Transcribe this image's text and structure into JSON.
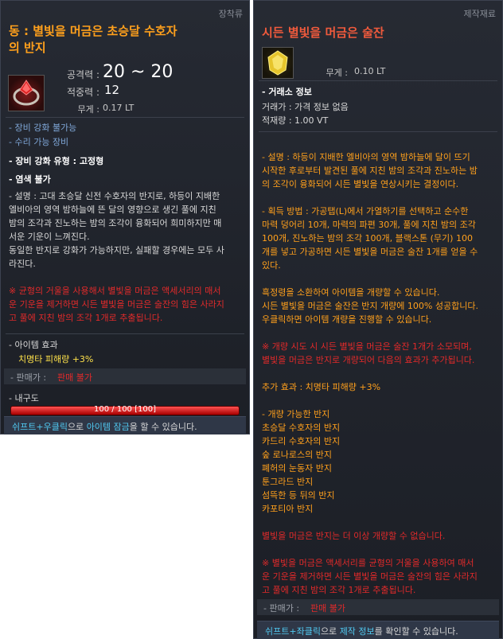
{
  "left": {
    "category": "장착류",
    "title_line1": "동 : 별빛을 머금은 초승달 수호자",
    "title_line2": "의 반지",
    "attack_label": "공격력 :",
    "attack_value": "20 ~ 20",
    "accuracy_label": "적중력 :",
    "accuracy_value": "12",
    "weight_label": "무게 :",
    "weight_value": "0.17 LT",
    "line_no_enhance": "- 장비 강화 불가능",
    "line_repairable": "- 수리 가능 장비",
    "line_enhance_type": "- 장비 강화 유형 : 고정형",
    "line_dye": "- 염색 불가",
    "desc": [
      "- 설명 : 고대 초승달 신전 수호자의 반지로, 하등이 지배한",
      "엘비아의 영역 밤하늘에 뜬 달의 영향으로 생긴 풀에 지친",
      "밤의 조각과 진노하는 밤의 조각이 융화되어 희미하지만 매",
      "서운 기운이 느껴진다.",
      "동일한 반지로 강화가 가능하지만, 실패할 경우에는 모두 사",
      "라진다."
    ],
    "warning": [
      "※ 균형의 거울을 사용해서 별빛을 머금은 액세서리의 매서",
      "운 기운을 제거하면 시든 별빛을 머금은 술잔의 힘은 사라지",
      "고 풀에 지친 밤의 조각 1개로 추출됩니다."
    ],
    "effect_header": "- 아이템 효과",
    "effect_value": "치명타 피해량 +3%",
    "sell_label": "- 판매가 :",
    "sell_value": "판매 불가",
    "durability_label": "- 내구도",
    "durability_text": "100 / 100 [100]",
    "durability_fraction": 1.0,
    "footer_a": "쉬프트+우클릭",
    "footer_b": "으로 ",
    "footer_c": "아이템 잠금",
    "footer_d": "을 할 수 있습니다."
  },
  "right": {
    "category": "제작재료",
    "title": "시든 별빛을 머금은 술잔",
    "weight_label": "무게 :",
    "weight_value": "0.10 LT",
    "market_header": "- 거래소 정보",
    "price_line": "거래가 : 가격 정보 없음",
    "stock_line": "적재량 : 1.00 VT",
    "desc": [
      "- 설명 : 하등이 지배한 엘비아의 영역 밤하늘에 달이 뜨기",
      "시작한 후로부터 발견된 풀에 지친 밤의 조각과 진노하는 밤",
      "의 조각이 융화되어 시든 별빛을 연상시키는 결정이다."
    ],
    "acquire": [
      "- 획득 방법 : 가공탭(L)에서 가열하기를 선택하고 순수한",
      "마력 덩어리 10개, 마력의 파편 30개, 풀에 지친 밤의 조각",
      "100개, 진노하는 밤의 조각 100개, 블랙스톤 (무기) 100",
      "개를 넣고 가공하면 시든 별빛을 머금은 술잔 1개를 얻을 수",
      "있다."
    ],
    "consume": [
      "흑정령을 소환하여 아이템을 개량할 수 있습니다.",
      "시든 별빛을 머금은 술잔은 반지 개량에 100% 성공합니다.",
      "우클릭하면 아이템 개량을 진행할 수 있습니다."
    ],
    "notice": [
      "※ 개량 시도 시 시든 별빛을 머금은 술잔 1개가 소모되며,",
      "별빛을 머금은 반지로 개량되어 다음의 효과가 추가됩니다."
    ],
    "extra_effect": "추가 효과 : 치명타 피해량 +3%",
    "rings_header": "- 개량 가능한 반지",
    "rings": [
      "초승달 수호자의 반지",
      "카드리 수호자의 반지",
      "숲 로나로스의 반지",
      "폐허의 눈동자 반지",
      "툰그라드 반지",
      "섬뜩한 등 뒤의 반지",
      "카포티아 반지"
    ],
    "cannot_upgrade": "별빛을 머금은 반지는 더 이상 개량할 수 없습니다.",
    "warning": [
      "※ 별빛을 머금은 액세서리를 균형의 거울을 사용하여 매서",
      "운 기운을 제거하면 시든 별빛을 머금은 술잔의 힘은 사라지",
      "고 풀에 지친 밤의 조각 1개로 추출됩니다."
    ],
    "sell_label": "- 판매가 :",
    "sell_value": "판매 불가",
    "footer_a": "쉬프트+좌클릭",
    "footer_b": "으로 ",
    "footer_c": "제작 정보",
    "footer_d": "를 확인할 수 있습니다."
  }
}
